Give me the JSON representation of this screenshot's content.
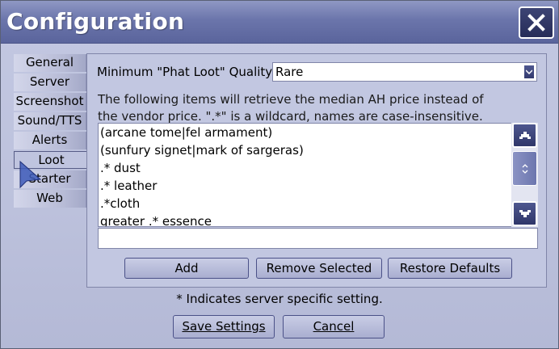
{
  "window": {
    "title": "Configuration",
    "close_icon": "close-icon"
  },
  "tabs": [
    {
      "label": "General"
    },
    {
      "label": "Server"
    },
    {
      "label": "Screenshot"
    },
    {
      "label": "Sound/TTS"
    },
    {
      "label": "Alerts"
    },
    {
      "label": "Loot",
      "active": true
    },
    {
      "label": "Starter"
    },
    {
      "label": "Web"
    }
  ],
  "loot": {
    "quality_label": "Minimum \"Phat Loot\" Quality:",
    "quality_value": "Rare",
    "description": "The following items will retrieve the median AH price instead of the vendor price. \".*\" is a wildcard, names are case-insensitive.",
    "items": [
      "(arcane tome|fel armament)",
      "(sunfury signet|mark of sargeras)",
      ".* dust",
      ".* leather",
      ".*cloth",
      "greater .* essence"
    ],
    "new_entry_value": "",
    "buttons": {
      "add": "Add",
      "remove": "Remove Selected",
      "restore": "Restore Defaults"
    }
  },
  "footer": {
    "note": "* Indicates server specific setting.",
    "save": "Save Settings",
    "cancel": "Cancel"
  },
  "colors": {
    "titlebar": "#6b75ab",
    "accent": "#2f3669",
    "background": "#bcc1dc"
  }
}
